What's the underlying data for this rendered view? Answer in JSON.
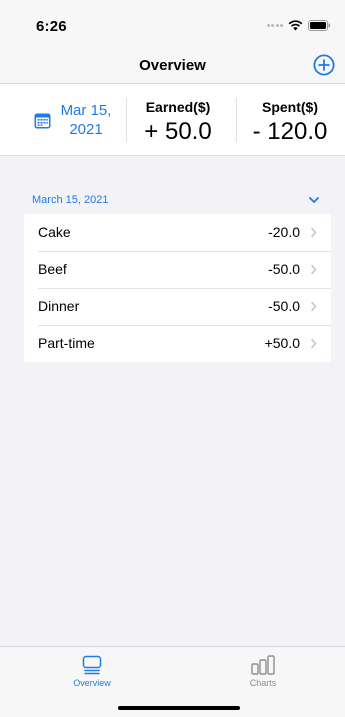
{
  "status_bar": {
    "time": "6:26"
  },
  "nav": {
    "title": "Overview",
    "add_icon": "plus-circle-icon"
  },
  "summary": {
    "date_line1": "Mar 15,",
    "date_line2": "2021",
    "earned_label": "Earned($)",
    "earned_value": "+ 50.0",
    "spent_label": "Spent($)",
    "spent_value": "- 120.0"
  },
  "section": {
    "title": "March 15, 2021",
    "chevron_icon": "chevron-down-icon"
  },
  "transactions": [
    {
      "name": "Cake",
      "amount": "-20.0"
    },
    {
      "name": "Beef",
      "amount": "-50.0"
    },
    {
      "name": "Dinner",
      "amount": "-50.0"
    },
    {
      "name": "Part-time",
      "amount": "+50.0"
    }
  ],
  "tabs": [
    {
      "label": "Overview",
      "icon": "overview-icon",
      "selected": true
    },
    {
      "label": "Charts",
      "icon": "bar-chart-icon",
      "selected": false
    }
  ],
  "colors": {
    "accent": "#1f7be6",
    "inactive": "#8e8e93"
  }
}
